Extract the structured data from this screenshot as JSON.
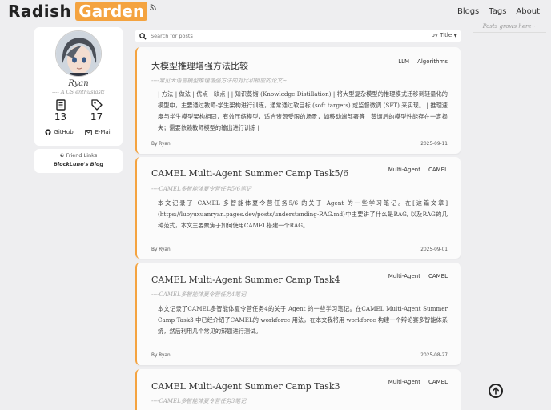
{
  "brand": {
    "part1": "Radish",
    "part2": "Garden"
  },
  "nav": {
    "blogs": "Blogs",
    "tags": "Tags",
    "about": "About"
  },
  "sidebar_hint": "Posts grows here~",
  "profile": {
    "name": "Ryan",
    "subtitle": "---- A CS enthusiast!",
    "posts_count": "13",
    "tags_count": "17",
    "github": "GitHub",
    "email": "E-Mail"
  },
  "friends": {
    "title": "Friend Links",
    "blog": "BlockLune's Blog"
  },
  "search": {
    "placeholder": "Search for posts",
    "sort": "by Title"
  },
  "posts": [
    {
      "title": "大模型推理增强方法比较",
      "subtitle": "----常见大语言模型推理增强方法的对比和相应的论文~",
      "tags": [
        "LLM",
        "Algorithms"
      ],
      "excerpt": "| 方法 | 做法 | 优点 | 缺点 | | 知识蒸馏 (Knowledge Distillation) | 将大型复杂模型的推理模式迁移到轻量化的模型中，主要通过教师-学生架构进行训练，通常通过软目标 (soft targets) 或监督微调 (SFT) 来实现。 | 推理速度与学生模型架构相同，有效压缩模型，适合资源受限的场景，如移动端部署等 | 蒸馏后的模型性能存在一定损失；需要依赖教师模型的输出进行训练 |",
      "author": "By Ryan",
      "date": "2025-09-11"
    },
    {
      "title": "CAMEL Multi-Agent Summer Camp Task5/6",
      "subtitle": "----CAMEL多智能体夏令营任务5/6笔记",
      "tags": [
        "Multi-Agent",
        "CAMEL"
      ],
      "excerpt": "本文记录了 CAMEL 多智能体夏令营任务5/6 的关于 Agent 的一些学习笔记。在[这篇文章](https://luoyuxuanryan.pages.dev/posts/understanding-RAG.md)中主要讲了什么是RAG, 以及RAG的几种范式，本文主要聚焦于如何使用CAMEL搭建一个RAG。",
      "author": "By Ryan",
      "date": "2025-09-01"
    },
    {
      "title": "CAMEL Multi-Agent Summer Camp Task4",
      "subtitle": "----CAMEL多智能体夏令营任务4笔记",
      "tags": [
        "Multi-Agent",
        "CAMEL"
      ],
      "excerpt": "本文记录了CAMEL多智能体夏令营任务4的关于 Agent 的一些学习笔记。在CAMEL Multi-Agent Summer Camp Task3 中已经介绍了CAMEL的 workforce 用法，在本文我将用 workforce 构建一个辩论赛多智能体系统，然后利用几个常见的辩题进行测试。",
      "author": "By Ryan",
      "date": "2025-08-27"
    },
    {
      "title": "CAMEL Multi-Agent Summer Camp Task3",
      "subtitle": "----CAMEL多智能体夏令营任务3笔记",
      "tags": [
        "Multi-Agent",
        "CAMEL"
      ]
    }
  ]
}
